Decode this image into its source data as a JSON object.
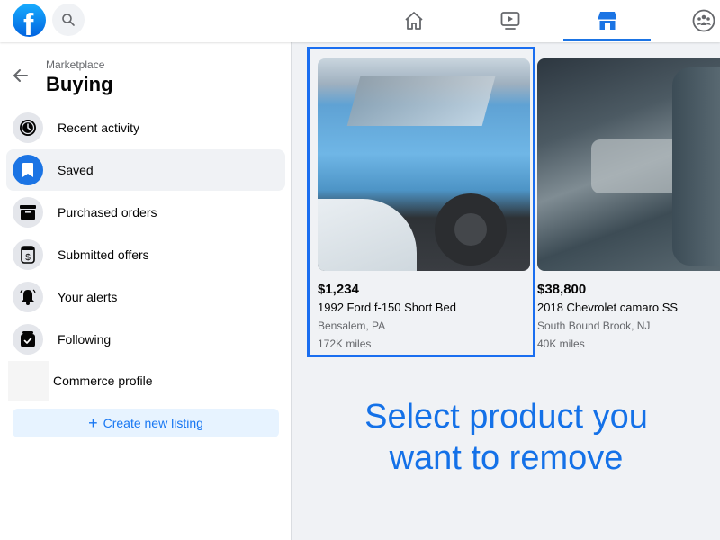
{
  "topbar": {
    "logo": "facebook-logo",
    "logo_letter": "f",
    "search_icon": "search-icon",
    "nav_tabs": [
      {
        "name": "home",
        "icon": "home-icon",
        "active": false
      },
      {
        "name": "watch",
        "icon": "video-icon",
        "active": false
      },
      {
        "name": "marketplace",
        "icon": "store-icon",
        "active": true
      },
      {
        "name": "groups",
        "icon": "groups-icon",
        "active": false
      }
    ],
    "accent_color": "#1b74e4"
  },
  "sidebar": {
    "breadcrumb": "Marketplace",
    "title": "Buying",
    "items": [
      {
        "label": "Recent activity",
        "icon": "clock-icon",
        "active": false
      },
      {
        "label": "Saved",
        "icon": "bookmark-icon",
        "active": true
      },
      {
        "label": "Purchased orders",
        "icon": "box-icon",
        "active": false
      },
      {
        "label": "Submitted offers",
        "icon": "offer-icon",
        "active": false
      },
      {
        "label": "Your alerts",
        "icon": "bell-icon",
        "active": false
      },
      {
        "label": "Following",
        "icon": "following-icon",
        "active": false
      },
      {
        "label": "Commerce profile",
        "icon": "profile-placeholder",
        "active": false
      }
    ],
    "create_button": {
      "icon": "+",
      "label": "Create new listing"
    }
  },
  "listings": [
    {
      "price": "$1,234",
      "title": "1992 Ford f-150 Short Bed",
      "location": "Bensalem, PA",
      "mileage": "172K miles",
      "selected": true
    },
    {
      "price": "$38,800",
      "title": "2018 Chevrolet camaro SS",
      "location": "South Bound Brook, NJ",
      "mileage": "40K miles",
      "selected": false
    }
  ],
  "instruction": {
    "line1": "Select product you",
    "line2": "want to remove",
    "color": "#1471e8"
  }
}
